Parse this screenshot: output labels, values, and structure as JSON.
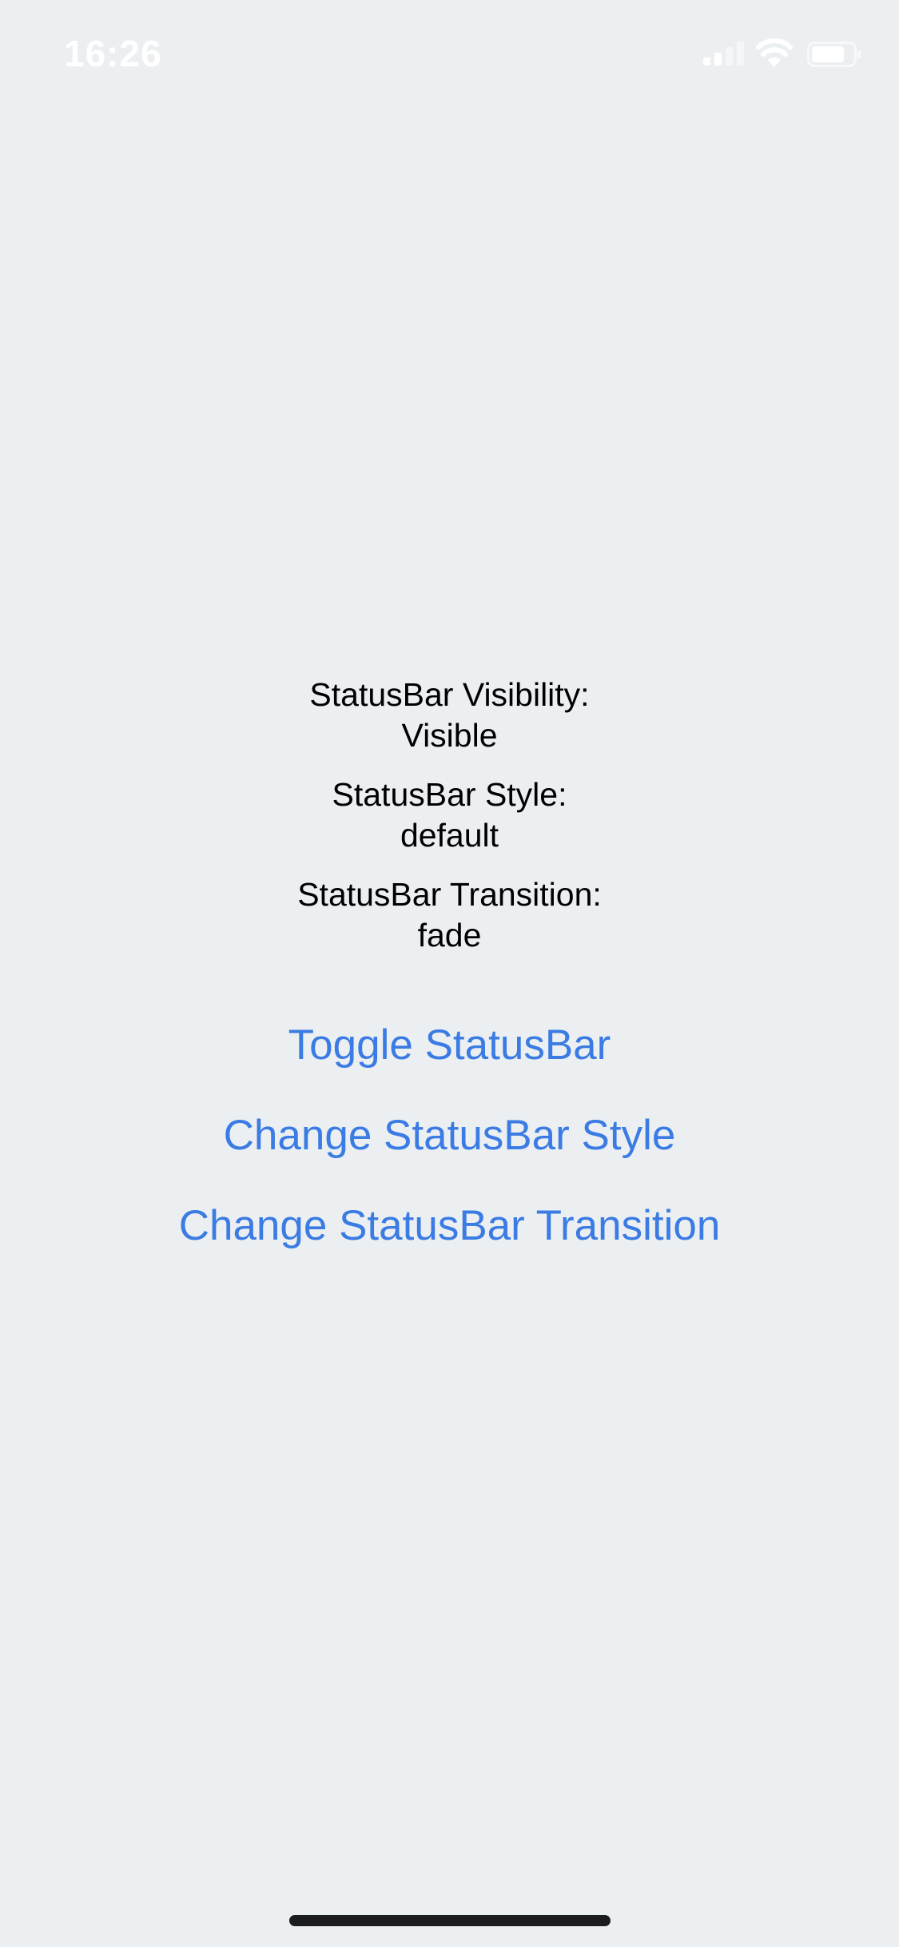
{
  "status_bar": {
    "time": "16:26",
    "icons": [
      "signal-icon",
      "wifi-icon",
      "battery-icon"
    ]
  },
  "info": {
    "visibility_label": "StatusBar Visibility:",
    "visibility_value": "Visible",
    "style_label": "StatusBar Style:",
    "style_value": "default",
    "transition_label": "StatusBar Transition:",
    "transition_value": "fade"
  },
  "actions": {
    "toggle": "Toggle StatusBar",
    "change_style": "Change StatusBar Style",
    "change_transition": "Change StatusBar Transition"
  },
  "colors": {
    "background": "#eceff1",
    "accent": "#3a7be4",
    "text": "#000000"
  }
}
